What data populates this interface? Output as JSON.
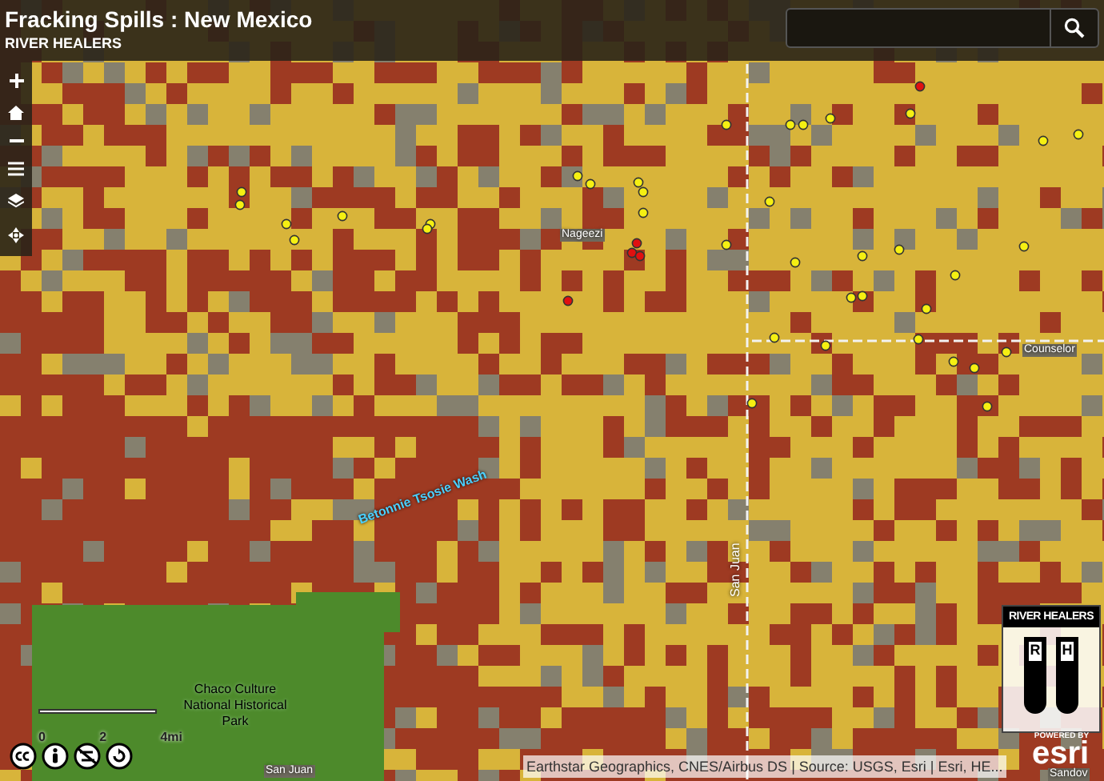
{
  "header": {
    "title": "Fracking Spills : New Mexico",
    "subtitle": "RIVER HEALERS"
  },
  "map": {
    "places": [
      {
        "kind": "town",
        "label": "Nageezi"
      },
      {
        "kind": "town",
        "label": "Counselor"
      },
      {
        "kind": "water",
        "label": "Betonnie Tsosie Wash"
      },
      {
        "kind": "vertical",
        "label": "San Juan"
      },
      {
        "kind": "park",
        "label": "Chaco Culture National Historical Park"
      },
      {
        "kind": "town",
        "label": "San Juan"
      },
      {
        "kind": "town",
        "label": "Sandov"
      }
    ],
    "scale": {
      "ticks": [
        "0",
        "2",
        "4mi"
      ]
    },
    "attribution": "Earthstar Geographics, CNES/Airbus DS | Source: USGS, Esri | Esri, HE...",
    "logo": {
      "title": "RIVER HEALERS",
      "letters": [
        "R",
        "H"
      ]
    },
    "esri": {
      "small": "POWERED BY",
      "brand": "esri"
    }
  }
}
